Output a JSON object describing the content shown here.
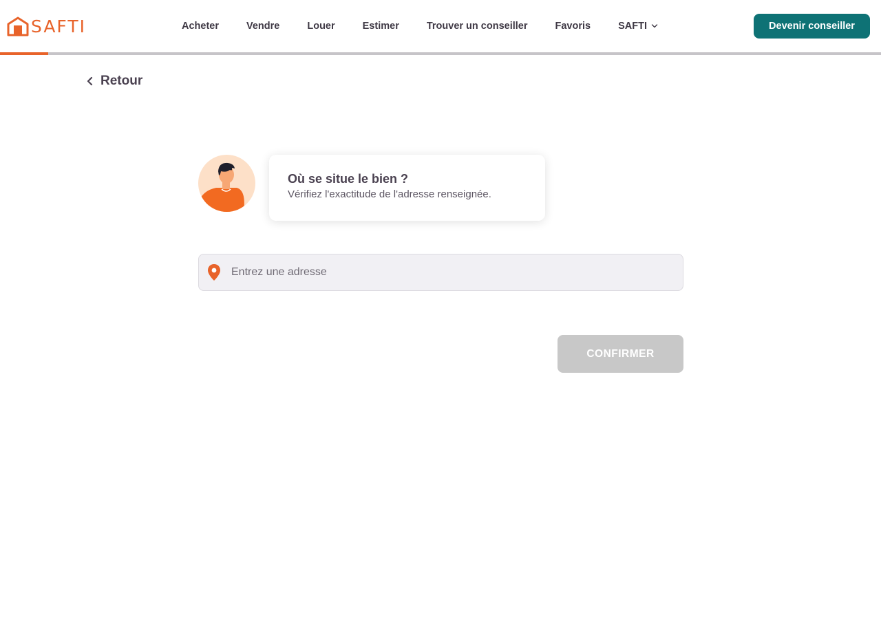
{
  "brand": {
    "name": "SAFTI",
    "accent_color": "#e8632a",
    "primary_color": "#0e7275"
  },
  "header": {
    "logo_text": "SAFTI",
    "logo_icon": "house-icon",
    "nav": [
      {
        "label": "Acheter"
      },
      {
        "label": "Vendre"
      },
      {
        "label": "Louer"
      },
      {
        "label": "Estimer"
      },
      {
        "label": "Trouver un conseiller"
      },
      {
        "label": "Favoris"
      },
      {
        "label": "SAFTI",
        "icon": "chevron-down-icon"
      }
    ],
    "cta_label": "Devenir conseiller"
  },
  "progress": {
    "value": 0.055
  },
  "back": {
    "label": "Retour",
    "icon": "chevron-left-icon"
  },
  "question": {
    "title": "Où se situe le bien ?",
    "subtitle": "Vérifiez l'exactitude de l'adresse renseignée."
  },
  "address": {
    "placeholder": "Entrez une adresse",
    "value": "",
    "icon": "map-pin-icon"
  },
  "confirm": {
    "label": "CONFIRMER",
    "disabled": true
  }
}
